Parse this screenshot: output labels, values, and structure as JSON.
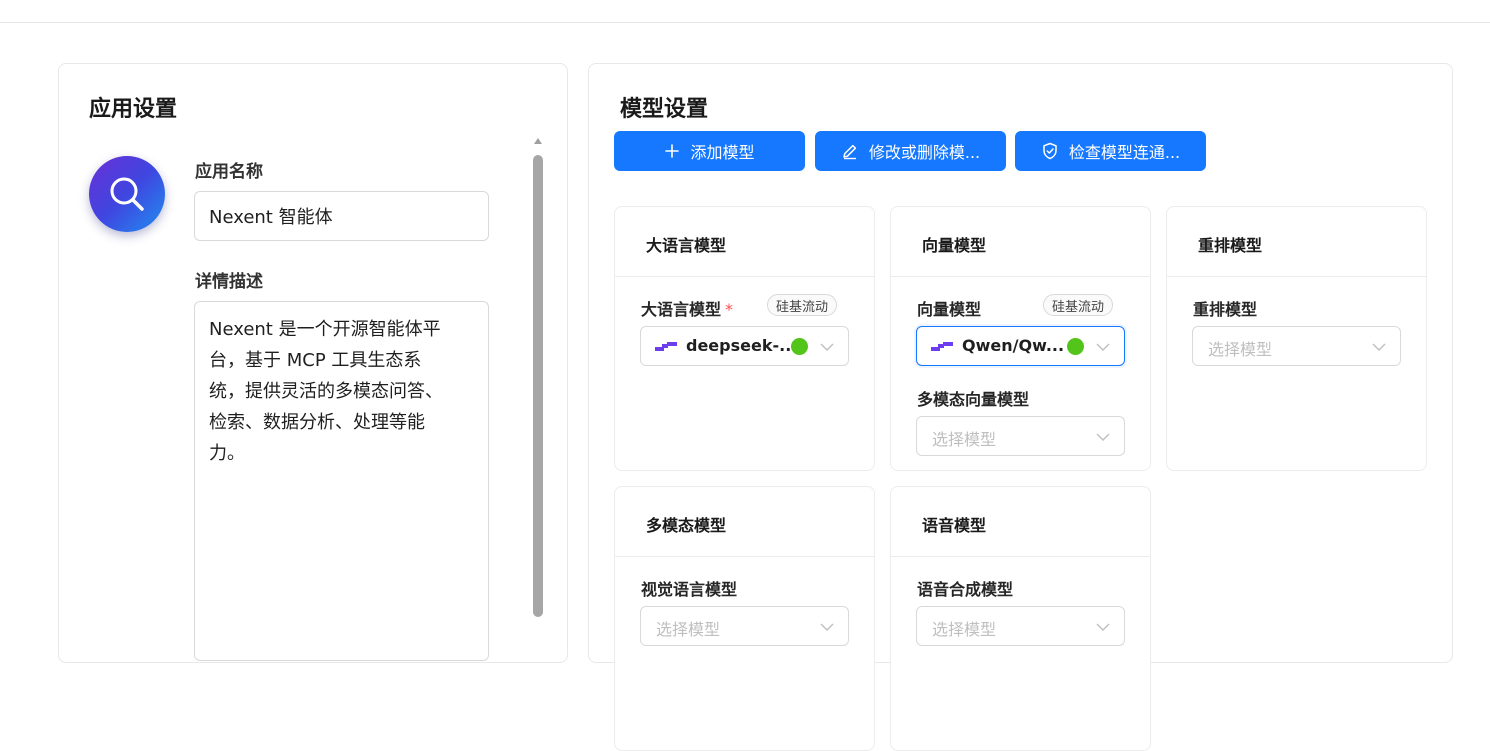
{
  "app_settings": {
    "title": "应用设置",
    "name_label": "应用名称",
    "name_value": "Nexent 智能体",
    "desc_label": "详情描述",
    "desc_value": "Nexent 是一个开源智能体平\n台，基于 MCP 工具生态系\n统，提供灵活的多模态问答、\n检索、数据分析、处理等能\n力。",
    "avatar_icon": "search-icon"
  },
  "model_settings": {
    "title": "模型设置",
    "buttons": [
      {
        "label": "添加模型",
        "icon": "plus-icon"
      },
      {
        "label": "修改或删除模...",
        "icon": "edit-icon"
      },
      {
        "label": "检查模型连通...",
        "icon": "shield-check-icon"
      }
    ],
    "cards": {
      "llm": {
        "title": "大语言模型",
        "field_label": "大语言模型",
        "required_mark": "*",
        "tag": "硅基流动",
        "selected": "deepseek-..."
      },
      "embedding": {
        "title": "向量模型",
        "field_label": "向量模型",
        "tag": "硅基流动",
        "selected": "Qwen/Qw...",
        "multi_label": "多模态向量模型",
        "multi_placeholder": "选择模型"
      },
      "rerank": {
        "title": "重排模型",
        "field_label": "重排模型",
        "placeholder": "选择模型"
      },
      "multimodal": {
        "title": "多模态模型",
        "field_label": "视觉语言模型",
        "placeholder": "选择模型"
      },
      "voice": {
        "title": "语音模型",
        "field_label": "语音合成模型",
        "placeholder": "选择模型"
      }
    }
  },
  "colors": {
    "primary": "#1677ff",
    "status_ok": "#52c41a",
    "required": "#ff4d4f",
    "avatar_gradient": [
      "#6a2fd6",
      "#1f8ff0"
    ]
  }
}
